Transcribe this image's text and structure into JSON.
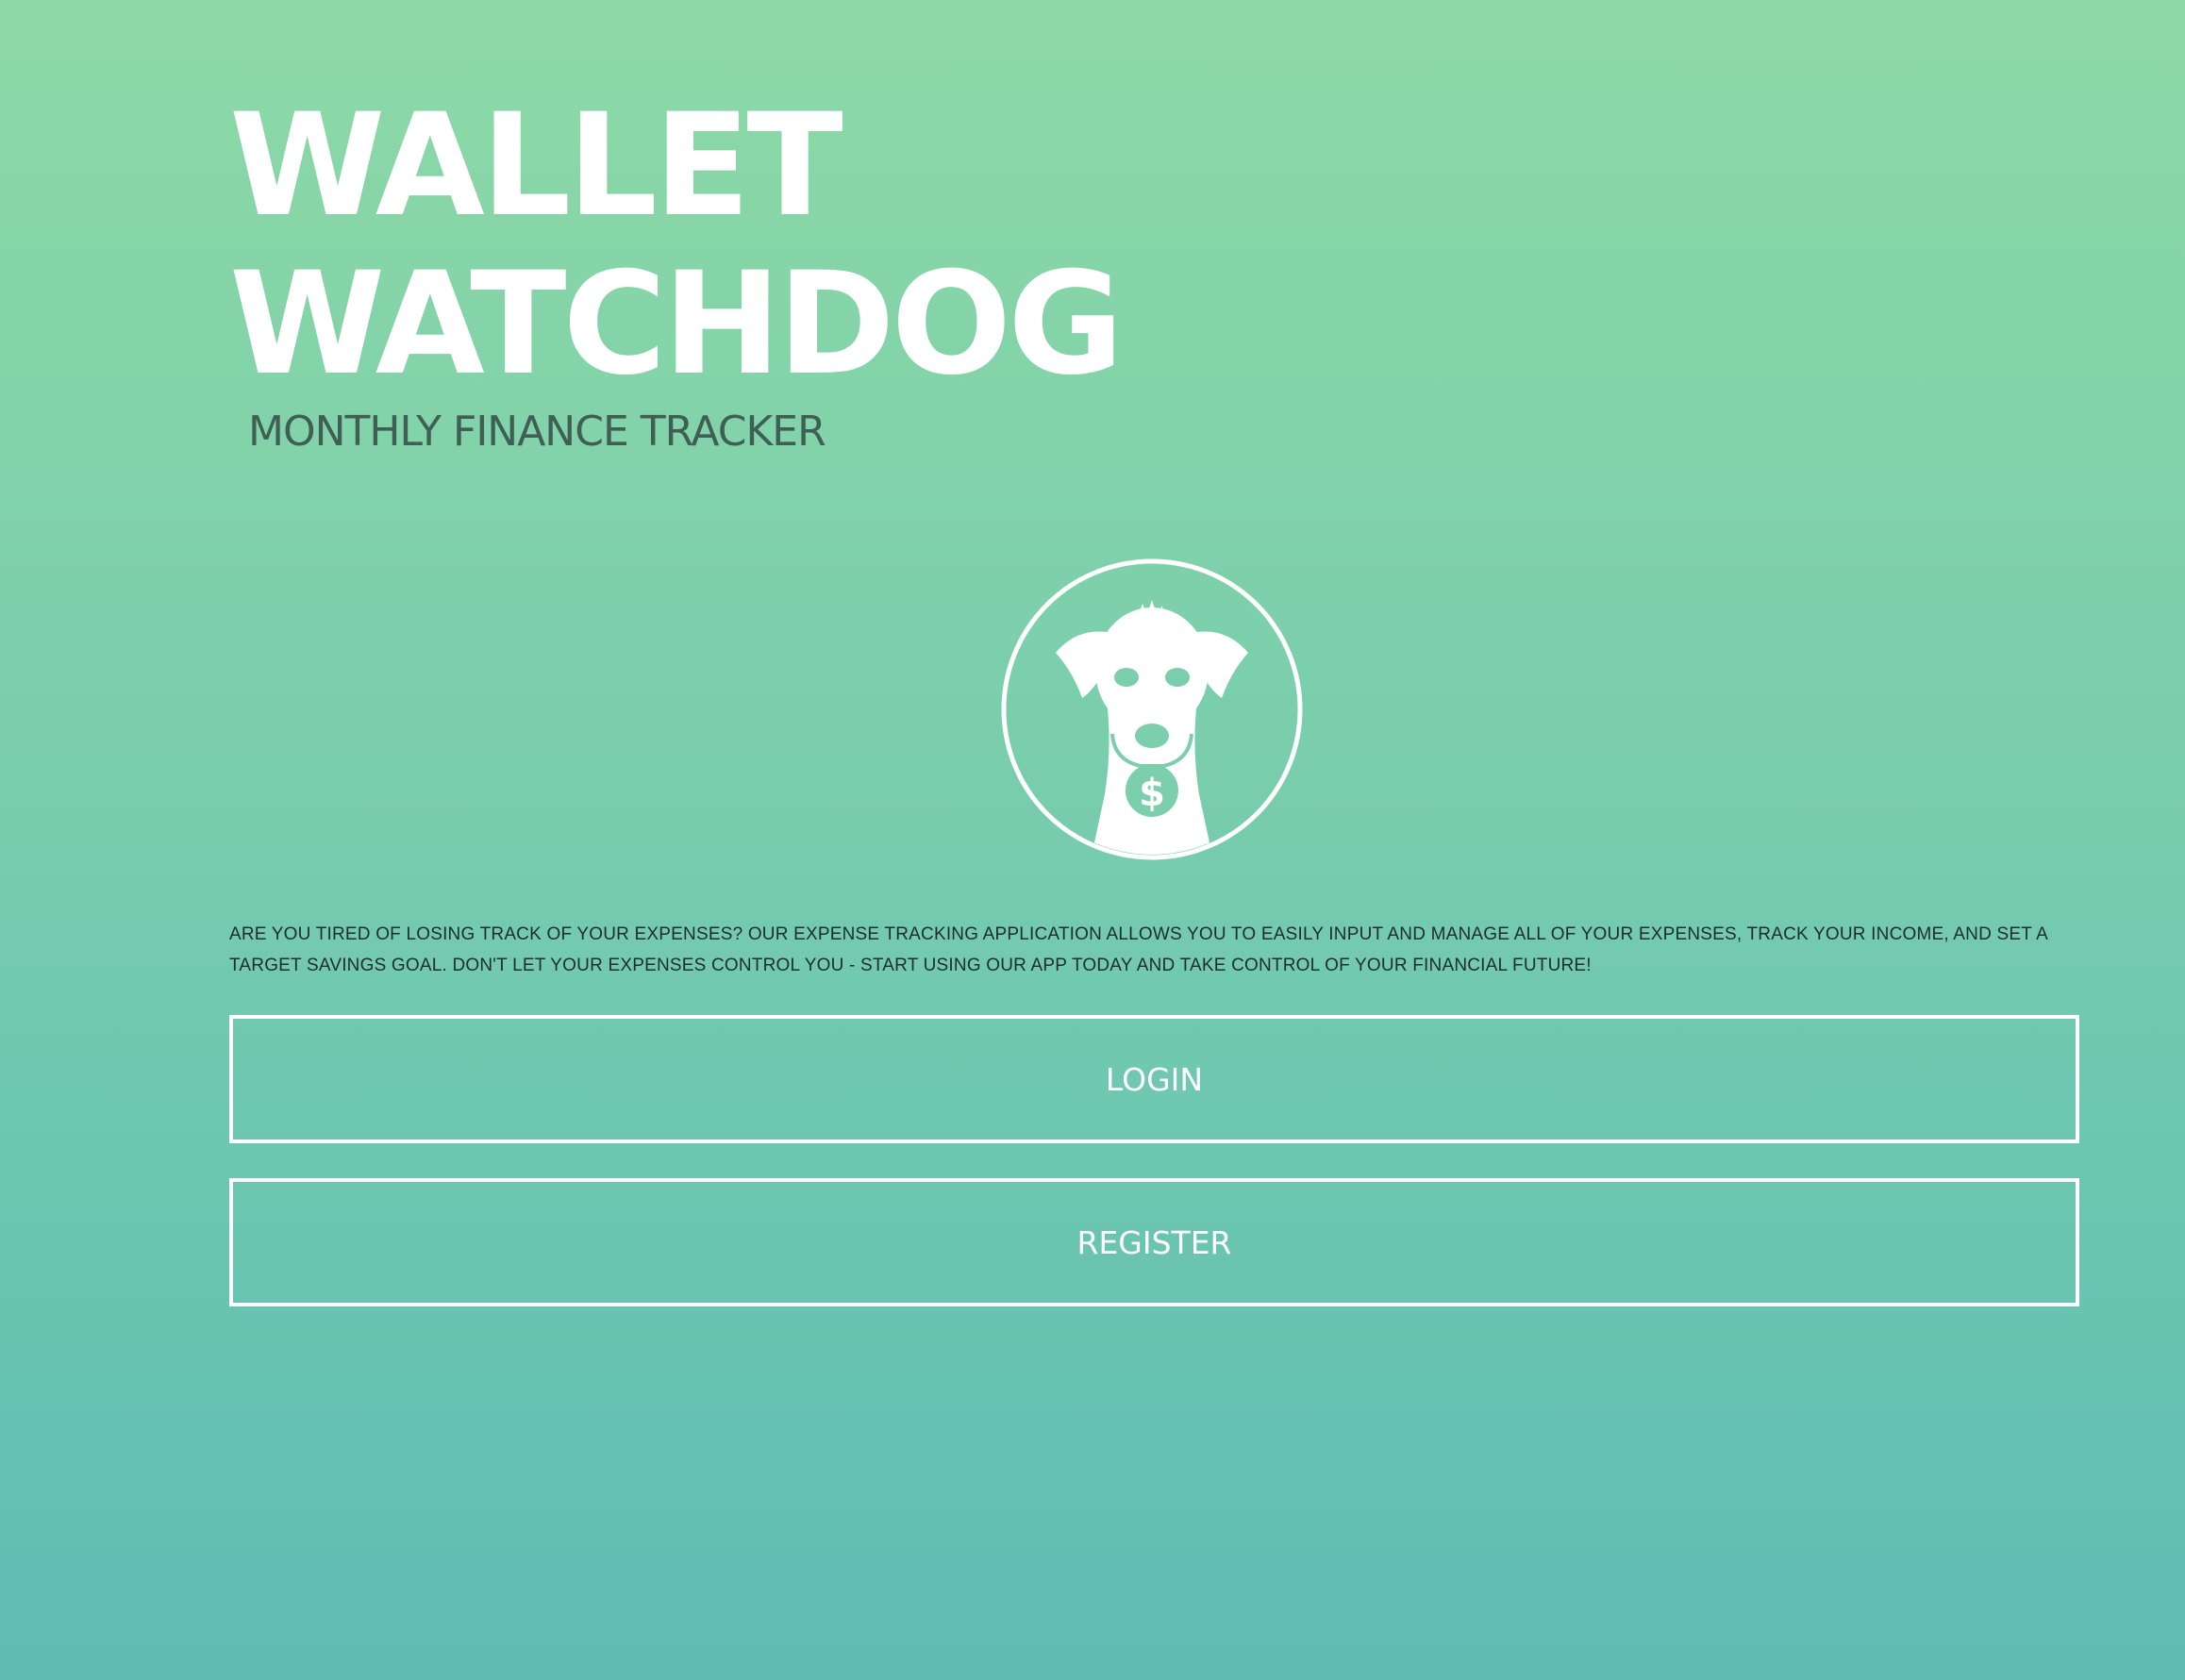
{
  "app": {
    "title_line1": "WALLET",
    "title_line2": "WATCHDOG",
    "subtitle": "MONTHLY FINANCE TRACKER",
    "logo_icon": "dog-logo-icon",
    "description": "ARE YOU TIRED OF LOSING TRACK OF YOUR EXPENSES? OUR EXPENSE TRACKING APPLICATION ALLOWS YOU TO EASILY INPUT AND MANAGE ALL OF YOUR EXPENSES, TRACK YOUR INCOME, AND SET A TARGET SAVINGS GOAL. DON'T LET YOUR EXPENSES CONTROL YOU - START USING OUR APP TODAY AND TAKE CONTROL OF YOUR FINANCIAL FUTURE!"
  },
  "actions": {
    "login_label": "LOGIN",
    "register_label": "REGISTER"
  },
  "colors": {
    "gradient_top": "#8dd9a6",
    "gradient_bottom": "#5ebcb3",
    "text_primary": "#ffffff",
    "subtitle": "#3f5f55",
    "description": "#1d2e2a"
  }
}
